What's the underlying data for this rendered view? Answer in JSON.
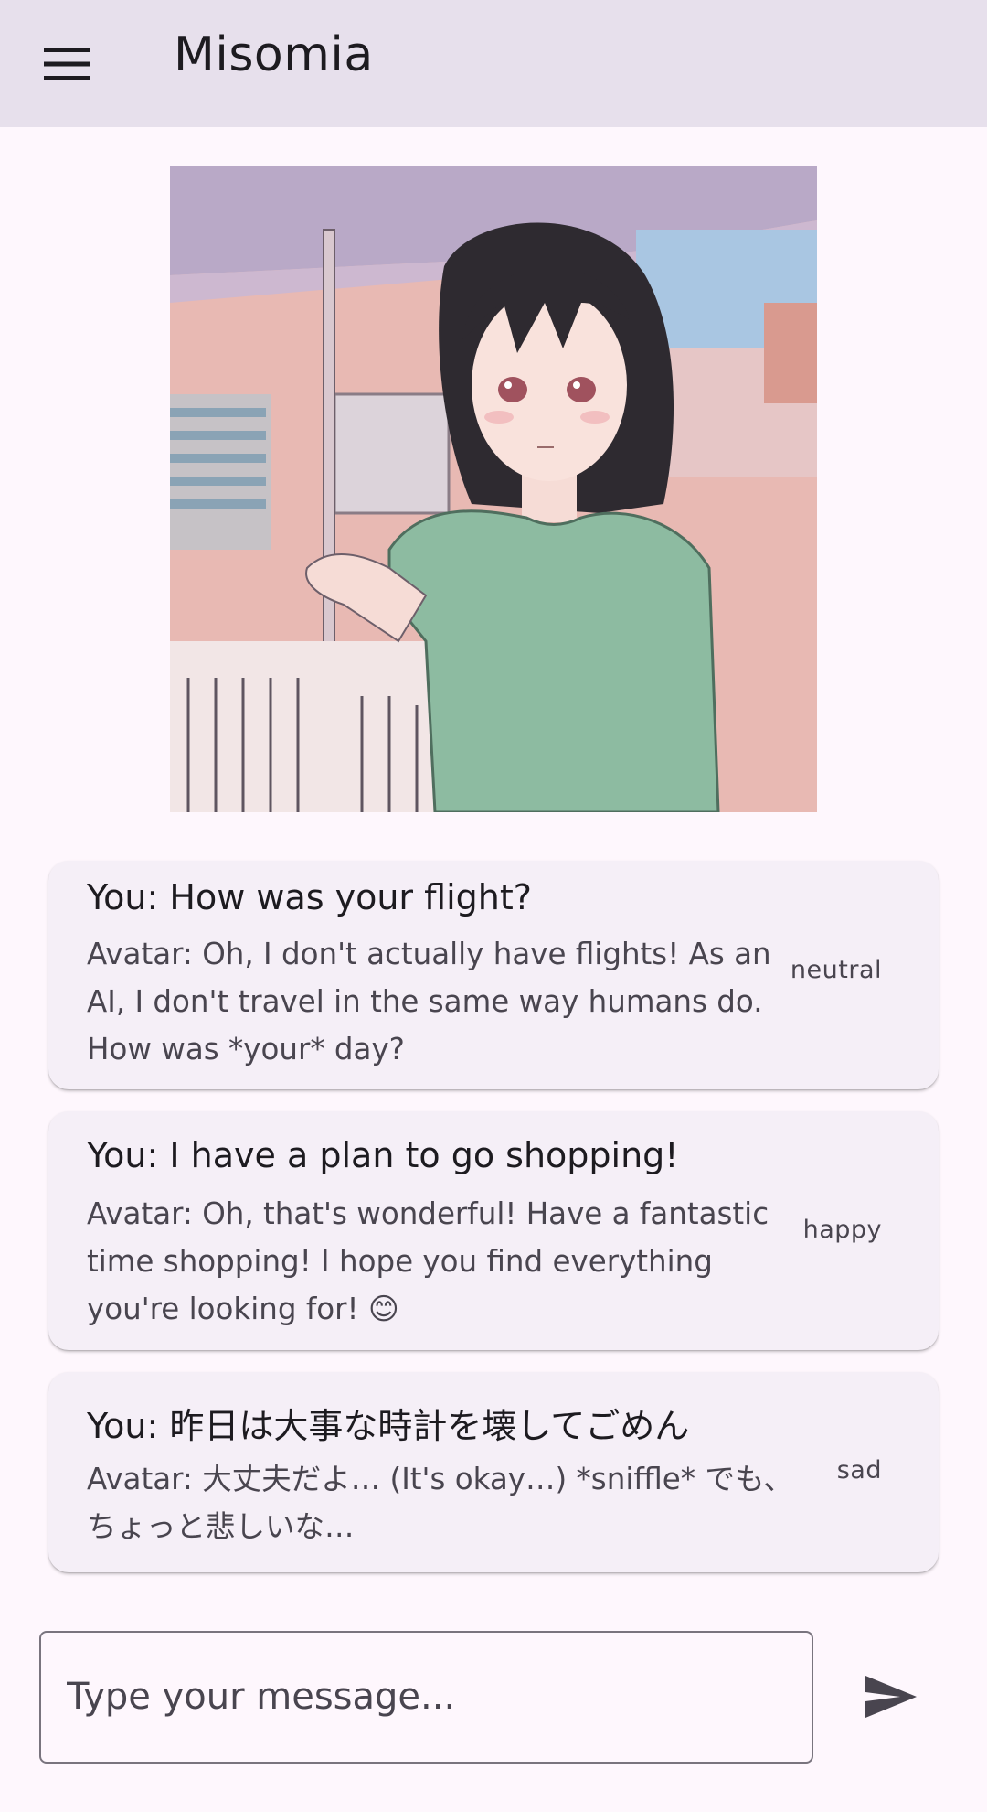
{
  "app_bar": {
    "menu_icon": "hamburger-menu-icon",
    "title": "Misomia"
  },
  "avatar": {
    "image": "anime-girl-avatar-illustration"
  },
  "messages": [
    {
      "user": "You: How was your flight?",
      "avatar": "Avatar: Oh, I don't actually have flights!  As an AI, I don't travel in the same way humans do.  How was *your* day?",
      "emotion": "neutral"
    },
    {
      "user": "You: I have a plan to go shopping!",
      "avatar": "Avatar: Oh, that's wonderful!  Have a fantastic time shopping!  I hope you find everything you're looking for!  😊",
      "emotion": "happy"
    },
    {
      "user": "You: 昨日は大事な時計を壊してごめん",
      "avatar": "Avatar: 大丈夫だよ… (It's okay…)  *sniffle*  でも、ちょっと悲しいな…",
      "emotion": "sad"
    }
  ],
  "composer": {
    "placeholder": "Type your message...",
    "value": "",
    "send_icon": "send-icon"
  },
  "colors": {
    "app_bar_bg": "#e7e0ec",
    "page_bg": "#fef7fd",
    "card_bg": "#f5eff7",
    "secondary_text": "#49454f",
    "outline": "#79747e"
  }
}
